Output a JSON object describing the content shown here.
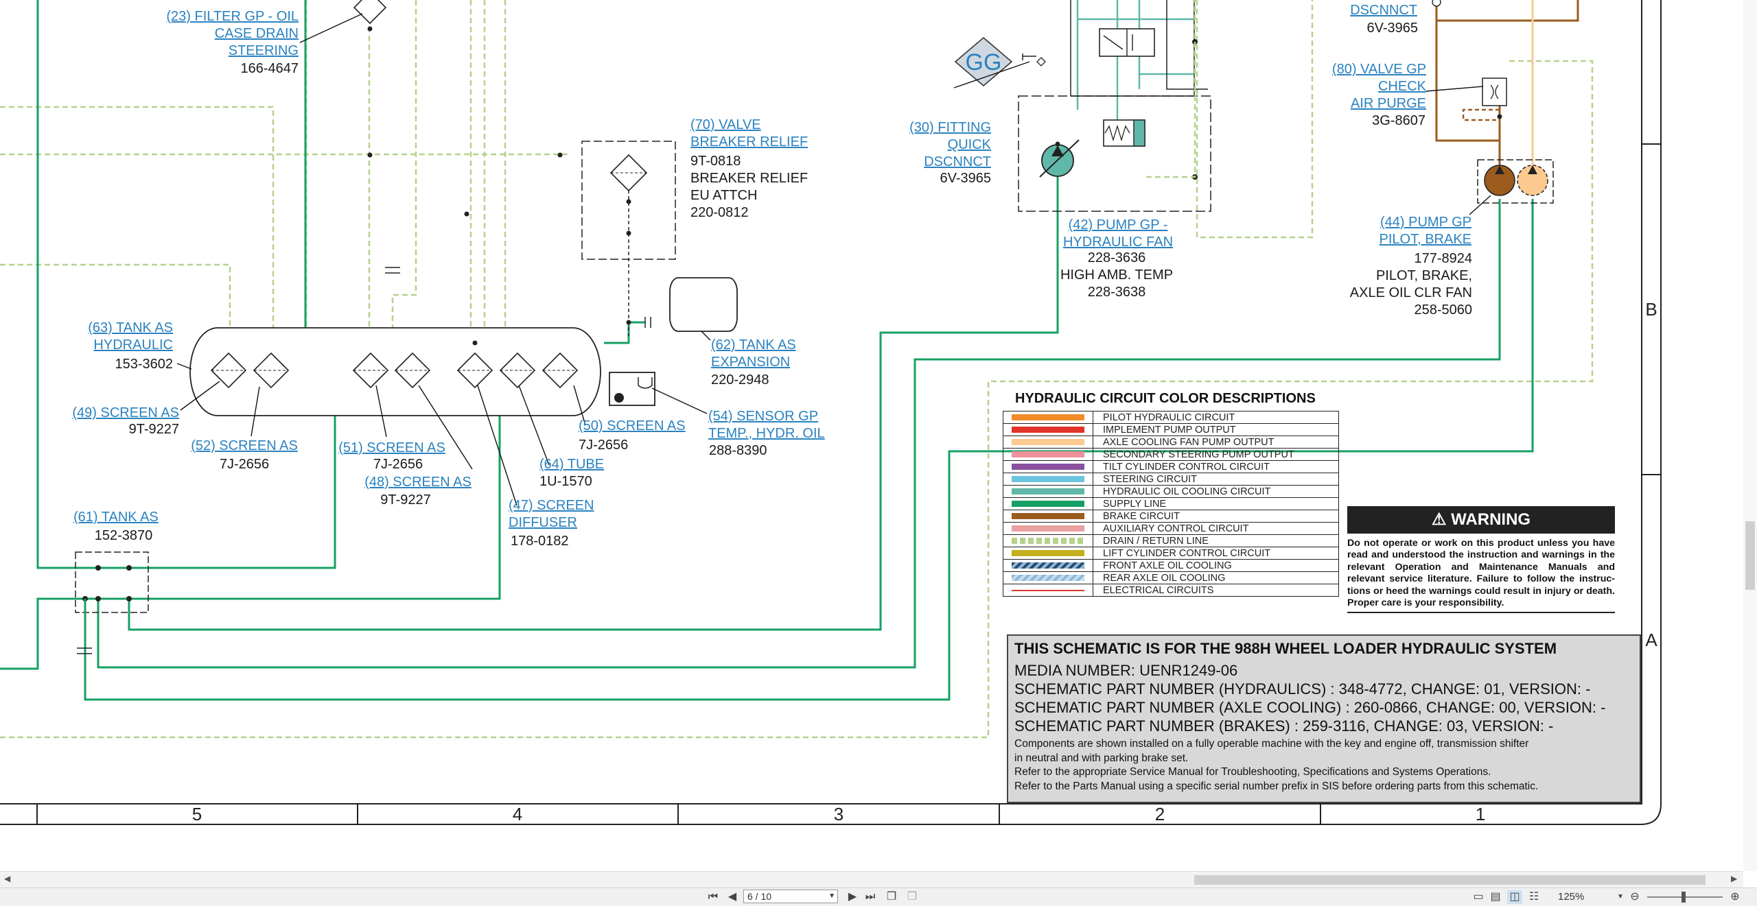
{
  "diagram": {
    "labels": {
      "l23": [
        "(23) FILTER GP - OIL",
        "CASE DRAIN",
        "STEERING"
      ],
      "l23pn": "166-4647",
      "l70": [
        "(70) VALVE",
        "BREAKER RELIEF"
      ],
      "l70pn": [
        "9T-0818",
        "BREAKER RELIEF",
        "EU ATTCH",
        "220-0812"
      ],
      "l63": [
        "(63) TANK AS",
        "HYDRAULIC"
      ],
      "l63pn": "153-3602",
      "l62": [
        "(62) TANK AS",
        "EXPANSION"
      ],
      "l62pn": "220-2948",
      "l49": "(49) SCREEN AS",
      "l49pn": "9T-9227",
      "l52": "(52) SCREEN AS",
      "l52pn": "7J-2656",
      "l51": "(51) SCREEN AS",
      "l51pn": "7J-2656",
      "l48": "(48) SCREEN AS",
      "l48pn": "9T-9227",
      "l50": "(50) SCREEN AS",
      "l50pn": "7J-2656",
      "l64": "(64) TUBE",
      "l64pn": "1U-1570",
      "l47": [
        "(47) SCREEN",
        "DIFFUSER"
      ],
      "l47pn": "178-0182",
      "l54": [
        "(54) SENSOR GP",
        "TEMP., HYDR. OIL"
      ],
      "l54pn": "288-8390",
      "l61": "(61) TANK AS",
      "l61pn": "152-3870",
      "l30": [
        "(30) FITTING",
        "QUICK",
        "DSCNNCT"
      ],
      "l30pn": "6V-3965",
      "gg": "GG",
      "l42": [
        "(42) PUMP GP -",
        "HYDRAULIC FAN"
      ],
      "l42pn": [
        "228-3636",
        "HIGH AMB. TEMP",
        "228-3638"
      ],
      "lds": "DSCNNCT",
      "ldspn": "6V-3965",
      "l80": [
        "(80) VALVE GP",
        "CHECK",
        "AIR PURGE"
      ],
      "l80pn": "3G-8607",
      "l44": [
        "(44) PUMP GP",
        "PILOT, BRAKE"
      ],
      "l44pn": [
        "177-8924",
        "PILOT, BRAKE,",
        "AXLE OIL CLR FAN",
        "258-5060"
      ]
    },
    "zones": [
      "5",
      "4",
      "3",
      "2",
      "1"
    ],
    "rows": [
      "B",
      "A"
    ]
  },
  "legend": {
    "title": "HYDRAULIC CIRCUIT COLOR DESCRIPTIONS",
    "items": [
      {
        "name": "PILOT HYDRAULIC CIRCUIT",
        "color": "#f28c28",
        "style": "solid"
      },
      {
        "name": "IMPLEMENT PUMP OUTPUT",
        "color": "#e0342b",
        "style": "solid"
      },
      {
        "name": "AXLE COOLING FAN PUMP OUTPUT",
        "color": "#fcc98e",
        "style": "solid"
      },
      {
        "name": "SECONDARY STEERING PUMP OUTPUT",
        "color": "#f0909a",
        "style": "solid"
      },
      {
        "name": "TILT CYLINDER CONTROL CIRCUIT",
        "color": "#8b4fa0",
        "style": "solid"
      },
      {
        "name": "STEERING CIRCUIT",
        "color": "#6cc3e0",
        "style": "solid"
      },
      {
        "name": "HYDRAULIC OIL COOLING CIRCUIT",
        "color": "#5fb8a8",
        "style": "solid"
      },
      {
        "name": "SUPPLY LINE",
        "color": "#16a063",
        "style": "solid"
      },
      {
        "name": "BRAKE CIRCUIT",
        "color": "#9a5b1d",
        "style": "solid"
      },
      {
        "name": "AUXILIARY CONTROL CIRCUIT",
        "color": "#e8a0a0",
        "style": "solid"
      },
      {
        "name": "DRAIN / RETURN LINE",
        "color": "#b5d28c",
        "style": "dashed"
      },
      {
        "name": "LIFT CYLINDER CONTROL CIRCUIT",
        "color": "#c3b01c",
        "style": "solid"
      },
      {
        "name": "FRONT AXLE OIL COOLING",
        "color": "#2a4d6e",
        "style": "hatch"
      },
      {
        "name": "REAR AXLE OIL COOLING",
        "color": "#8fb9d9",
        "style": "hatch"
      },
      {
        "name": "ELECTRICAL CIRCUITS",
        "color": "#e0342b",
        "style": "thin"
      }
    ]
  },
  "warning": {
    "title": "WARNING",
    "text": "Do not operate or work on this product unless you have read and understood the instruction and warnings in the relevant Operation and Maintenance Manuals and relevant service literature. Failure to follow the instruc-tions or heed the warnings could result in injury or death. Proper care is your responsibility."
  },
  "info": {
    "title": "THIS SCHEMATIC IS FOR THE 988H WHEEL LOADER HYDRAULIC SYSTEM",
    "media": "MEDIA NUMBER: UENR1249-06",
    "parts": [
      "SCHEMATIC PART NUMBER (HYDRAULICS) : 348-4772, CHANGE: 01, VERSION: -",
      "SCHEMATIC PART NUMBER (AXLE COOLING) : 260-0866, CHANGE: 00, VERSION: -",
      "SCHEMATIC PART NUMBER (BRAKES) : 259-3116, CHANGE: 03, VERSION: -"
    ],
    "notes": [
      "Components are shown installed on a fully operable machine with the key and engine off, transmission shifter",
      "in neutral and with parking brake set.",
      "Refer to the appropriate Service Manual for Troubleshooting, Specifications and Systems Operations.",
      "Refer to the Parts Manual using a specific serial number prefix in SIS before ordering parts from this schematic."
    ]
  },
  "viewer": {
    "page": "6 / 10",
    "zoom": "125%"
  }
}
